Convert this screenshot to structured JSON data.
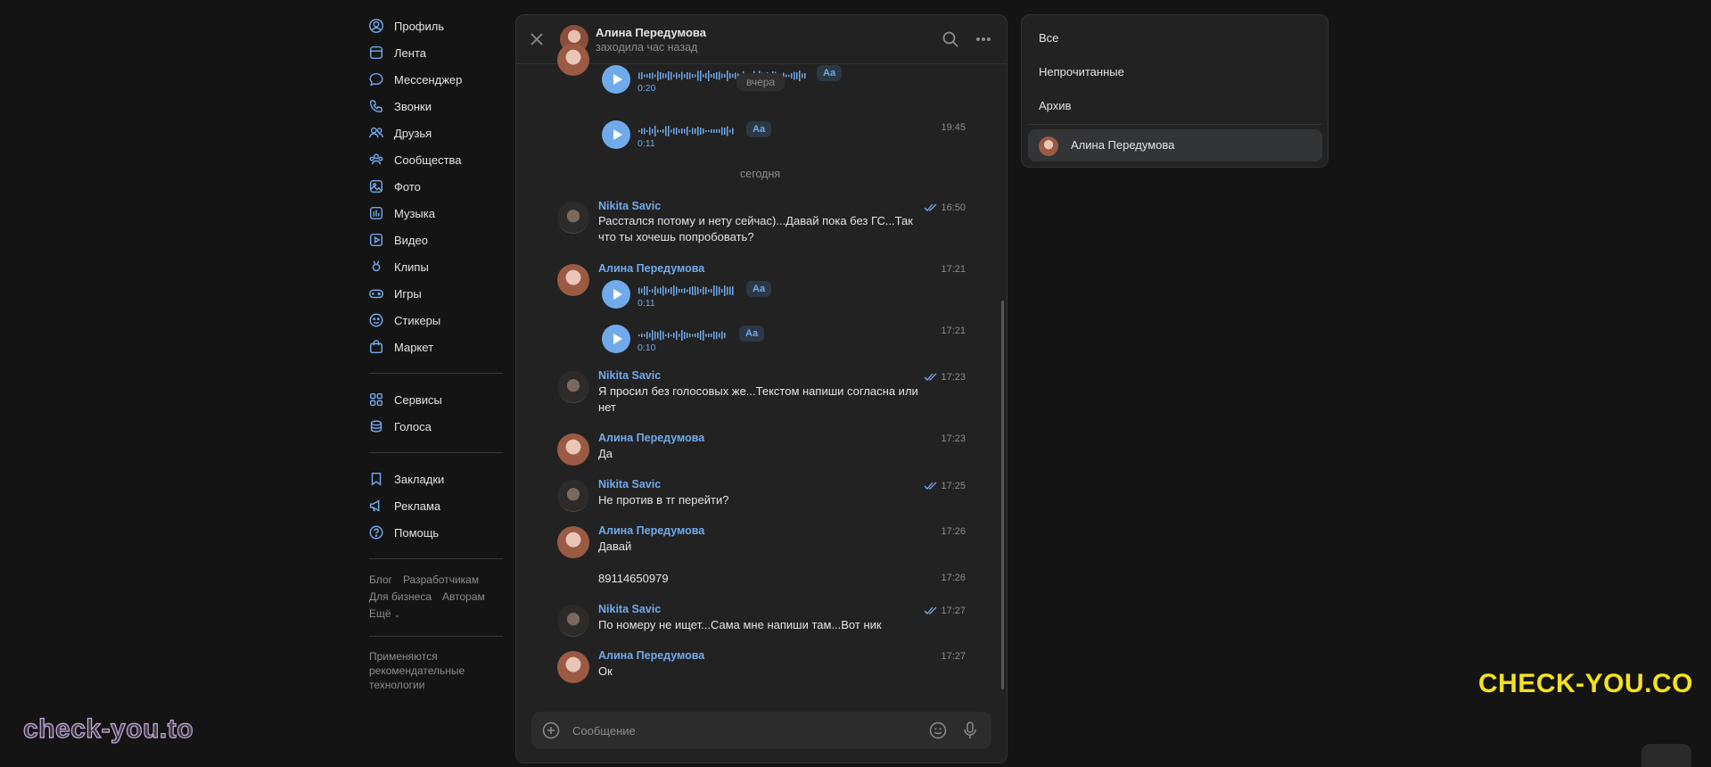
{
  "nav": {
    "items": [
      {
        "label": "Профиль",
        "icon": "profile-icon"
      },
      {
        "label": "Лента",
        "icon": "feed-icon"
      },
      {
        "label": "Мессенджер",
        "icon": "messenger-icon"
      },
      {
        "label": "Звонки",
        "icon": "phone-icon"
      },
      {
        "label": "Друзья",
        "icon": "friends-icon"
      },
      {
        "label": "Сообщества",
        "icon": "communities-icon"
      },
      {
        "label": "Фото",
        "icon": "photo-icon"
      },
      {
        "label": "Музыка",
        "icon": "music-icon"
      },
      {
        "label": "Видео",
        "icon": "video-icon"
      },
      {
        "label": "Клипы",
        "icon": "clips-icon"
      },
      {
        "label": "Игры",
        "icon": "games-icon"
      },
      {
        "label": "Стикеры",
        "icon": "stickers-icon"
      },
      {
        "label": "Маркет",
        "icon": "market-icon"
      }
    ],
    "items2": [
      {
        "label": "Сервисы",
        "icon": "services-icon"
      },
      {
        "label": "Голоса",
        "icon": "votes-icon"
      }
    ],
    "items3": [
      {
        "label": "Закладки",
        "icon": "bookmark-icon"
      },
      {
        "label": "Реклама",
        "icon": "ads-icon"
      },
      {
        "label": "Помощь",
        "icon": "help-icon"
      }
    ],
    "footer_links": [
      "Блог",
      "Разработчикам",
      "Для бизнеса",
      "Авторам",
      "Ещё"
    ],
    "footer_note": "Применяются рекомендательные технологии"
  },
  "chat": {
    "title": "Алина Передумова",
    "status": "заходила час назад",
    "day_pill": "вчера",
    "day_today": "сегодня",
    "composer_placeholder": "Сообщение",
    "voice_top": {
      "duration": "0:20",
      "aa": "Aa"
    },
    "voice_y2": {
      "duration": "0:11",
      "aa": "Aa",
      "time": "19:45"
    },
    "messages": [
      {
        "author": "Nikita Savic",
        "text": "Расстался потому и нету сейчас)...Давай пока без ГС...Так что ты хочешь попробовать?",
        "time": "16:50"
      },
      {
        "author": "Алина Передумова",
        "time": "17:21",
        "voice": {
          "duration": "0:11",
          "aa": "Aa"
        }
      },
      {
        "time": "17:21",
        "voice": {
          "duration": "0:10",
          "aa": "Aa"
        }
      },
      {
        "author": "Nikita Savic",
        "text": "Я просил без голосовых же...Текстом напиши согласна или нет",
        "time": "17:23"
      },
      {
        "author": "Алина Передумова",
        "text": "Да",
        "time": "17:23"
      },
      {
        "author": "Nikita Savic",
        "text": "Не против в тг перейти?",
        "time": "17:25"
      },
      {
        "author": "Алина Передумова",
        "text": "Давай",
        "time": "17:26"
      },
      {
        "text": "89114650979",
        "time": "17:26"
      },
      {
        "author": "Nikita Savic",
        "text": "По номеру не ищет...Сама мне напиши там...Вот ник",
        "time": "17:27"
      },
      {
        "author": "Алина Передумова",
        "text": "Ок",
        "time": "17:27"
      }
    ]
  },
  "filters": {
    "items": [
      "Все",
      "Непрочитанные",
      "Архив"
    ],
    "active_chat": "Алина Передумова"
  },
  "watermarks": {
    "left": "check-you.to",
    "right": "CHECK-YOU.CO"
  },
  "colors": {
    "accent": "#71aaeb",
    "background": "#141414",
    "panel": "#222222",
    "watermark_right": "#f4e222"
  }
}
